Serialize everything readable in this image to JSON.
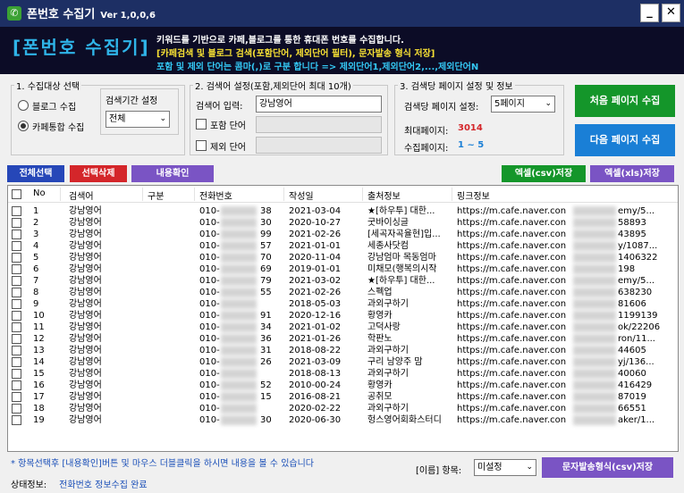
{
  "window": {
    "title": "폰번호 수집기",
    "version": "Ver 1,0,0,6",
    "minimize": "_",
    "close": "✕",
    "app_icon": "phone-icon"
  },
  "banner": {
    "logo": "[폰번호 수집기]",
    "line1": "키워드를 기반으로 카페,블로그를 통한 휴대폰 번호를 수집합니다.",
    "line2": "[카페검색 및 블로그 검색(포함단어, 제외단어 필터), 문자발송 형식 저장]",
    "line3": "포함 및 제외 단어는 콤마(,)로 구분 합니다 => 제외단어1,제외단어2,...,제외단어N"
  },
  "target": {
    "legend": "1. 수집대상 선택",
    "blog": "블로그 수집",
    "cafe": "카페통합 수집",
    "period_label": "검색기간 설정",
    "period_value": "전체",
    "selected": "cafe"
  },
  "keyword": {
    "legend": "2. 검색어 설정(포함,제외단어 최대 10개)",
    "input_label": "검색어 입력:",
    "input_value": "강남영어",
    "include_label": "포함 단어",
    "exclude_label": "제외 단어",
    "include_value": "",
    "exclude_value": ""
  },
  "pages": {
    "legend": "3. 검색당 페이지 설정 및 정보",
    "per_label": "검색당 페이지 설정:",
    "per_value": "5페이지",
    "max_label": "최대페이지:",
    "max_value": "3014",
    "collected_label": "수집페이지:",
    "collected_value": "1 ~ 5"
  },
  "buttons": {
    "first": "처음 페이지 수집",
    "next": "다음 페이지 수집",
    "select_all": "전체선택",
    "delete_selected": "선택삭제",
    "view": "내용확인",
    "excel_csv": "엑셀(csv)저장",
    "excel_xls": "엑셀(xls)저장",
    "sms_csv": "문자발송형식(csv)저장"
  },
  "colors": {
    "green": "#14962a",
    "blue": "#1a7fd6",
    "red": "#d4262a",
    "purple": "#7a54c4",
    "navy": "#2647b8"
  },
  "table": {
    "columns": [
      "No",
      "검색어",
      "구분",
      "전화번호",
      "작성일",
      "출처정보",
      "링크정보"
    ],
    "rows": [
      {
        "no": "1",
        "kw": "강남영어",
        "phone": "010-",
        "tail": "38",
        "date": "2021-03-04",
        "src": "★[하우투] 대한...",
        "link": "https://m.cafe.naver.con",
        "lt": "emy/5..."
      },
      {
        "no": "2",
        "kw": "강남영어",
        "phone": "010-",
        "tail": "30",
        "date": "2020-10-27",
        "src": "굿바이싱글",
        "link": "https://m.cafe.naver.con",
        "lt": "58893"
      },
      {
        "no": "3",
        "kw": "강남영어",
        "phone": "010-",
        "tail": "99",
        "date": "2021-02-26",
        "src": "[세곡자곡율현]입...",
        "link": "https://m.cafe.naver.con",
        "lt": "43895"
      },
      {
        "no": "4",
        "kw": "강남영어",
        "phone": "010-",
        "tail": "57",
        "date": "2021-01-01",
        "src": "세종사닷컴",
        "link": "https://m.cafe.naver.con",
        "lt": "y/1087..."
      },
      {
        "no": "5",
        "kw": "강남영어",
        "phone": "010-",
        "tail": "70",
        "date": "2020-11-04",
        "src": "강남엄마 목동엄마",
        "link": "https://m.cafe.naver.con",
        "lt": "1406322"
      },
      {
        "no": "6",
        "kw": "강남영어",
        "phone": "010-",
        "tail": "69",
        "date": "2019-01-01",
        "src": "미채모(행복의시작",
        "link": "https://m.cafe.naver.con",
        "lt": "198"
      },
      {
        "no": "7",
        "kw": "강남영어",
        "phone": "010-",
        "tail": "79",
        "date": "2021-03-02",
        "src": "★[하우투] 대한...",
        "link": "https://m.cafe.naver.con",
        "lt": "emy/5..."
      },
      {
        "no": "8",
        "kw": "강남영어",
        "phone": "010-",
        "tail": "55",
        "date": "2021-02-26",
        "src": "스펙업",
        "link": "https://m.cafe.naver.con",
        "lt": "638230"
      },
      {
        "no": "9",
        "kw": "강남영어",
        "phone": "010-",
        "tail": "",
        "date": "2018-05-03",
        "src": "과외구하기",
        "link": "https://m.cafe.naver.con",
        "lt": "81606"
      },
      {
        "no": "10",
        "kw": "강남영어",
        "phone": "010-",
        "tail": "91",
        "date": "2020-12-16",
        "src": "황영카",
        "link": "https://m.cafe.naver.con",
        "lt": "1199139"
      },
      {
        "no": "11",
        "kw": "강남영어",
        "phone": "010-",
        "tail": "34",
        "date": "2021-01-02",
        "src": "고덕사랑",
        "link": "https://m.cafe.naver.con",
        "lt": "ok/22206"
      },
      {
        "no": "12",
        "kw": "강남영어",
        "phone": "010-",
        "tail": "36",
        "date": "2021-01-26",
        "src": "학판노",
        "link": "https://m.cafe.naver.con",
        "lt": "ron/11..."
      },
      {
        "no": "13",
        "kw": "강남영어",
        "phone": "010-",
        "tail": "31",
        "date": "2018-08-22",
        "src": "과외구하기",
        "link": "https://m.cafe.naver.con",
        "lt": "44605"
      },
      {
        "no": "14",
        "kw": "강남영어",
        "phone": "010-",
        "tail": "26",
        "date": "2021-03-09",
        "src": "구리 남양주 맘",
        "link": "https://m.cafe.naver.con",
        "lt": "yj/136..."
      },
      {
        "no": "15",
        "kw": "강남영어",
        "phone": "010-",
        "tail": "",
        "date": "2018-08-13",
        "src": "과외구하기",
        "link": "https://m.cafe.naver.con",
        "lt": "40060"
      },
      {
        "no": "16",
        "kw": "강남영어",
        "phone": "010-",
        "tail": "52",
        "date": "2010-00-24",
        "src": "황영카",
        "link": "https://m.cafe.naver.con",
        "lt": "416429"
      },
      {
        "no": "17",
        "kw": "강남영어",
        "phone": "010-",
        "tail": "15",
        "date": "2016-08-21",
        "src": "공취모",
        "link": "https://m.cafe.naver.con",
        "lt": "87019"
      },
      {
        "no": "18",
        "kw": "강남영어",
        "phone": "010-",
        "tail": "",
        "date": "2020-02-22",
        "src": "과외구하기",
        "link": "https://m.cafe.naver.con",
        "lt": "66551"
      },
      {
        "no": "19",
        "kw": "강남영어",
        "phone": "010-",
        "tail": "30",
        "date": "2020-06-30",
        "src": "헝스영어회화스터디",
        "link": "https://m.cafe.naver.con",
        "lt": "aker/1..."
      }
    ]
  },
  "footer": {
    "note": "* 항목선택후 [내용확인]버튼 및 마우스 더블클릭을 하시면 내용을 볼 수 있습니다",
    "item_label": "[이름] 항목:",
    "item_value": "미설정",
    "status_label": "상태정보:",
    "status_value": "전화번호 정보수집 완료"
  }
}
